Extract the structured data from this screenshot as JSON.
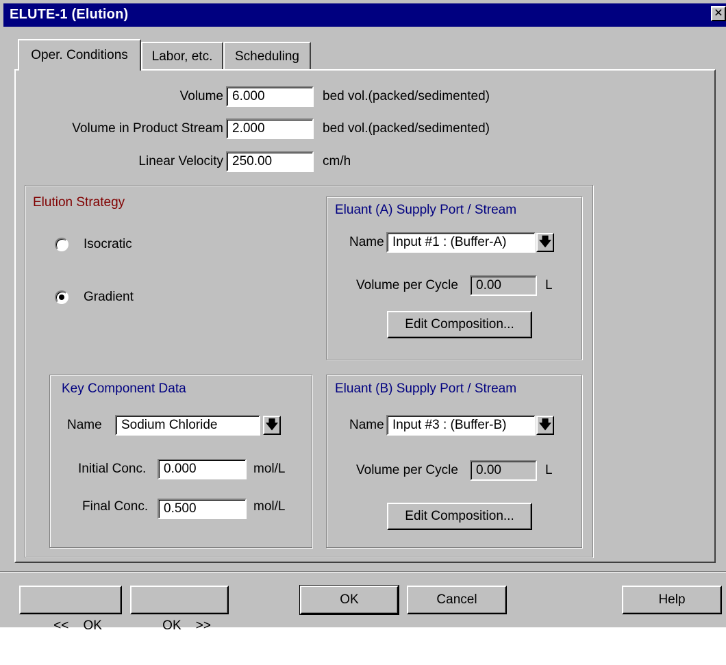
{
  "window": {
    "title": "ELUTE-1 (Elution)",
    "close_glyph": "✕"
  },
  "tabs": [
    {
      "label": "Oper. Conditions",
      "active": true
    },
    {
      "label": "Labor, etc.",
      "active": false
    },
    {
      "label": "Scheduling",
      "active": false
    }
  ],
  "operating": {
    "volume": {
      "label": "Volume",
      "value": "6.000",
      "unit": "bed vol.(packed/sedimented)"
    },
    "volume_product": {
      "label": "Volume in Product Stream",
      "value": "2.000",
      "unit": "bed vol.(packed/sedimented)"
    },
    "linear_velocity": {
      "label": "Linear Velocity",
      "value": "250.00",
      "unit": "cm/h"
    }
  },
  "elution_strategy": {
    "title": "Elution Strategy",
    "options": [
      {
        "label": "Isocratic",
        "selected": false
      },
      {
        "label": "Gradient",
        "selected": true
      }
    ]
  },
  "eluant_a": {
    "title": "Eluant (A) Supply Port / Stream",
    "name_label": "Name",
    "name_value": "Input #1 : (Buffer-A)",
    "volume_label": "Volume per Cycle",
    "volume_value": "0.00",
    "volume_unit": "L",
    "edit_button": "Edit Composition..."
  },
  "eluant_b": {
    "title": "Eluant (B) Supply Port / Stream",
    "name_label": "Name",
    "name_value": "Input #3 : (Buffer-B)",
    "volume_label": "Volume per Cycle",
    "volume_value": "0.00",
    "volume_unit": "L",
    "edit_button": "Edit Composition..."
  },
  "key_component": {
    "title": "Key Component Data",
    "name_label": "Name",
    "name_value": "Sodium Chloride",
    "initial_label": "Initial Conc.",
    "initial_value": "0.000",
    "initial_unit": "mol/L",
    "final_label": "Final Conc.",
    "final_value": "0.500",
    "final_unit": "mol/L"
  },
  "footer": {
    "prev_ok": "<<    OK",
    "next_ok": "OK    >>",
    "ok": "OK",
    "cancel": "Cancel",
    "help": "Help"
  },
  "icons": {
    "dropdown": "🡇"
  },
  "colors": {
    "title_bar": "#000080",
    "group_title_red": "#800000",
    "group_title_blue": "#000080"
  }
}
